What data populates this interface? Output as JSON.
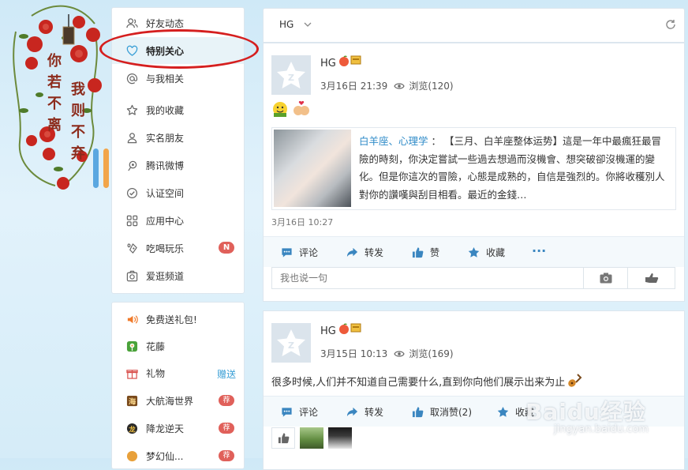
{
  "decoration": {
    "vertical_text_left": [
      "你",
      "若",
      "不",
      "离"
    ],
    "vertical_text_right": [
      "我",
      "则",
      "不",
      "弃"
    ],
    "stripe_colors": [
      "#5aa7e0",
      "#f2a54a",
      "#ea5f9c",
      "#9ccf45"
    ]
  },
  "sidebar": {
    "items": [
      {
        "label": "好友动态",
        "icon": "friends-icon"
      },
      {
        "label": "特别关心",
        "icon": "heart-icon"
      },
      {
        "label": "与我相关",
        "icon": "at-icon"
      },
      {
        "label": "我的收藏",
        "icon": "star-icon"
      },
      {
        "label": "实名朋友",
        "icon": "id-card-icon"
      },
      {
        "label": "腾讯微博",
        "icon": "weibo-icon"
      },
      {
        "label": "认证空间",
        "icon": "verified-icon"
      },
      {
        "label": "应用中心",
        "icon": "apps-icon"
      },
      {
        "label": "吃喝玩乐",
        "icon": "food-icon",
        "badge": "N"
      },
      {
        "label": "爱逛频道",
        "icon": "camera-icon"
      }
    ],
    "apps": [
      {
        "label": "免费送礼包!",
        "icon": "gift-voice-icon"
      },
      {
        "label": "花藤",
        "icon": "flower-icon"
      },
      {
        "label": "礼物",
        "icon": "present-icon",
        "link": "赠送"
      },
      {
        "label": "大航海世界",
        "icon": "sea-icon",
        "badge": "荐"
      },
      {
        "label": "降龙逆天",
        "icon": "dragon-icon",
        "badge": "荐"
      },
      {
        "label": "梦幻仙...",
        "icon": "fantasy-icon",
        "badge": "荐"
      }
    ]
  },
  "feed": {
    "user": "HG",
    "posts": [
      {
        "author": "HG",
        "date": "3月16日 21:39",
        "views_label": "浏览(120)",
        "share_author": "白羊座、心理学",
        "share_sep": "：",
        "share_text": "【三月、白羊座整体运势】這是一年中最瘋狂最冒險的時刻，你決定嘗試一些過去想過而沒機會、想突破卻沒機運的變化。但是你這次的冒險，心態是成熟的，自信是強烈的。你將收穫別人對你的讚嘆與刮目相看。最近的金錢…",
        "time": "3月16日 10:27",
        "actions": {
          "comment": "评论",
          "forward": "转发",
          "like": "赞",
          "favorite": "收藏",
          "more": "···"
        },
        "comment_placeholder": "我也说一句"
      },
      {
        "author": "HG",
        "date": "3月15日 10:13",
        "views_label": "浏览(169)",
        "text": "很多时候,人们并不知道自己需要什么,直到你向他们展示出来为止",
        "actions": {
          "comment": "评论",
          "forward": "转发",
          "like": "取消赞(2)",
          "favorite": "收藏"
        }
      }
    ]
  },
  "watermark": {
    "main": "Baidu经验",
    "sub": "jingyan.baidu.com"
  },
  "colors": {
    "accent": "#3a9fd6",
    "badge": "#e0605a",
    "action_icon": "#3a86c0",
    "highlight": "#d51f1f"
  }
}
